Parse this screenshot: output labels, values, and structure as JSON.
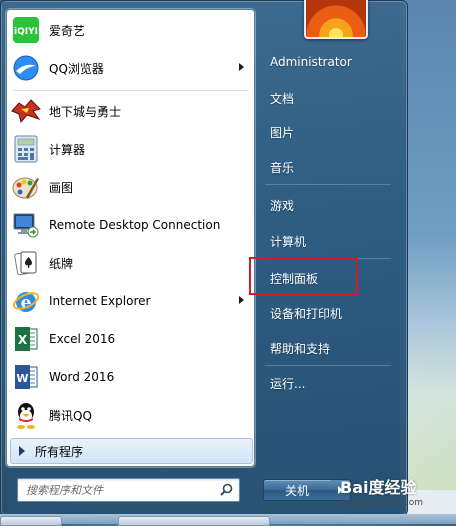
{
  "programs": [
    {
      "label": "爱奇艺",
      "icon": "iqiyi-icon",
      "has_submenu": false
    },
    {
      "label": "QQ浏览器",
      "icon": "qq-browser-icon",
      "has_submenu": true
    },
    {
      "label": "地下城与勇士",
      "icon": "dnf-game-icon",
      "has_submenu": false
    },
    {
      "label": "计算器",
      "icon": "calculator-icon",
      "has_submenu": false
    },
    {
      "label": "画图",
      "icon": "paint-icon",
      "has_submenu": false
    },
    {
      "label": "Remote Desktop Connection",
      "icon": "remote-desktop-icon",
      "has_submenu": false
    },
    {
      "label": "纸牌",
      "icon": "solitaire-icon",
      "has_submenu": false
    },
    {
      "label": "Internet Explorer",
      "icon": "internet-explorer-icon",
      "has_submenu": true
    },
    {
      "label": "Excel 2016",
      "icon": "excel-icon",
      "has_submenu": false
    },
    {
      "label": "Word 2016",
      "icon": "word-icon",
      "has_submenu": false
    },
    {
      "label": "腾讯QQ",
      "icon": "qq-icon",
      "has_submenu": false
    }
  ],
  "all_programs_label": "所有程序",
  "search": {
    "placeholder": "搜索程序和文件"
  },
  "right_menu": {
    "user": "Administrator",
    "documents": "文档",
    "pictures": "图片",
    "music": "音乐",
    "games": "游戏",
    "computer": "计算机",
    "control_panel": "控制面板",
    "devices_printers": "设备和打印机",
    "help_support": "帮助和支持",
    "run": "运行..."
  },
  "shutdown_label": "关机",
  "watermark": {
    "logo": "Bai度经验",
    "url": "jingyan.baidu.com"
  },
  "colors": {
    "highlight_border": "#d11a2a",
    "menu_blue": "#2d5c82"
  }
}
